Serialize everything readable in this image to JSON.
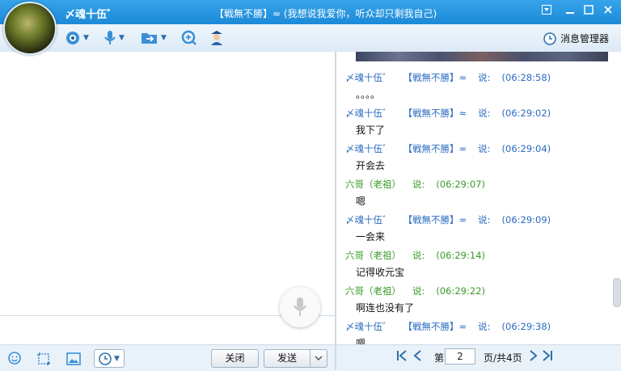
{
  "title": {
    "name": "〆魂十伍゛",
    "signature": "【戦無不勝】≈ (我想说我爱你，听众却只剩我自己)"
  },
  "toolbar": {
    "icons": [
      "video-icon",
      "mic-icon",
      "folder-transfer-icon",
      "remote-assist-icon",
      "police-icon"
    ],
    "message_manager": "消息管理器"
  },
  "buttons": {
    "close": "关闭",
    "send": "发送"
  },
  "messages": [
    {
      "sender": "〆魂十伍゛",
      "tag": "【戦無不勝】≈",
      "said": "说:",
      "time": "(06:28:58)",
      "text": "。。。。",
      "color": "blue"
    },
    {
      "sender": "〆魂十伍゛",
      "tag": "【戦無不勝】≈",
      "said": "说:",
      "time": "(06:29:02)",
      "text": "我下了",
      "color": "blue"
    },
    {
      "sender": "〆魂十伍゛",
      "tag": "【戦無不勝】≈",
      "said": "说:",
      "time": "(06:29:04)",
      "text": "开会去",
      "color": "blue"
    },
    {
      "sender": "六哥（老祖）",
      "tag": "",
      "said": "说:",
      "time": "(06:29:07)",
      "text": "嗯",
      "color": "green"
    },
    {
      "sender": "〆魂十伍゛",
      "tag": "【戦無不勝】≈",
      "said": "说:",
      "time": "(06:29:09)",
      "text": "一会来",
      "color": "blue"
    },
    {
      "sender": "六哥（老祖）",
      "tag": "",
      "said": "说:",
      "time": "(06:29:14)",
      "text": "记得收元宝",
      "color": "green"
    },
    {
      "sender": "六哥（老祖）",
      "tag": "",
      "said": "说:",
      "time": "(06:29:22)",
      "text": "啊连也没有了",
      "color": "green"
    },
    {
      "sender": "〆魂十伍゛",
      "tag": "【戦無不勝】≈",
      "said": "说:",
      "time": "(06:29:38)",
      "text": "嗯",
      "color": "blue"
    }
  ],
  "pager": {
    "page_prefix": "第",
    "page_value": "2",
    "page_suffix": "页/共4页"
  }
}
